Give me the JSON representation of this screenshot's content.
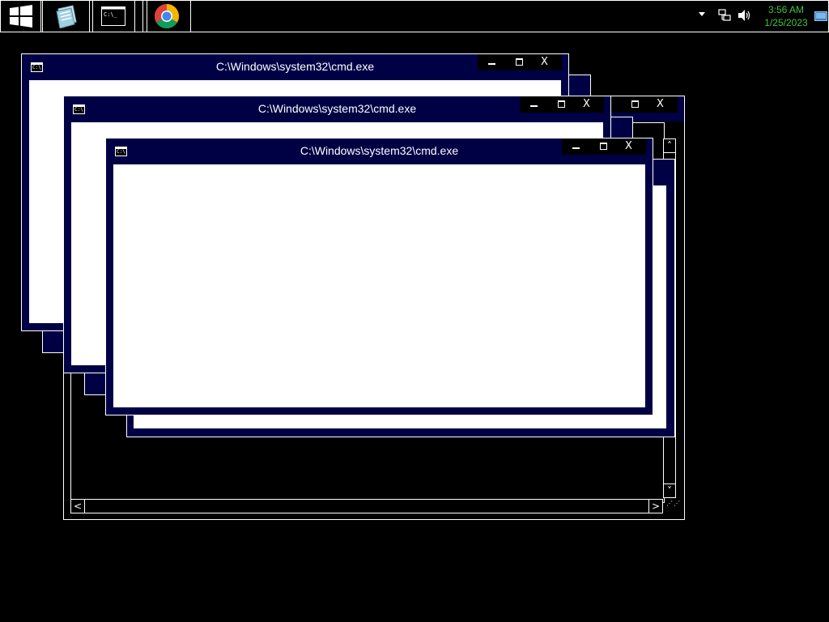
{
  "taskbar": {
    "start_icon": "windows-logo-icon",
    "apps": [
      {
        "name": "server-manager",
        "icon": "notepad-book-icon"
      },
      {
        "name": "command-prompt",
        "icon": "cmd-icon"
      },
      {
        "name": "chrome",
        "icon": "chrome-icon"
      }
    ],
    "tray": {
      "overflow_icon": "chevron-up-icon",
      "network_icon": "network-icon",
      "volume_icon": "speaker-icon",
      "time": "3:56 AM",
      "date": "1/25/2023",
      "clock_color": "#3ec43e"
    }
  },
  "windows": [
    {
      "title": "C:\\Windows\\system32\\cmd.exe",
      "close_label": "X"
    },
    {
      "title": "C:\\Windows\\system32\\cmd.exe",
      "close_label": "X"
    },
    {
      "title": "C:\\Windows\\system32\\cmd.exe",
      "close_label": "X"
    },
    {
      "title": "",
      "close_label": "X"
    }
  ],
  "scrollbar": {
    "up": "˄",
    "down": "˅",
    "left": "<",
    "right": ">"
  },
  "colors": {
    "window_frame": "#000044",
    "desktop": "#000000",
    "client": "#ffffff",
    "border": "#ffffff"
  }
}
